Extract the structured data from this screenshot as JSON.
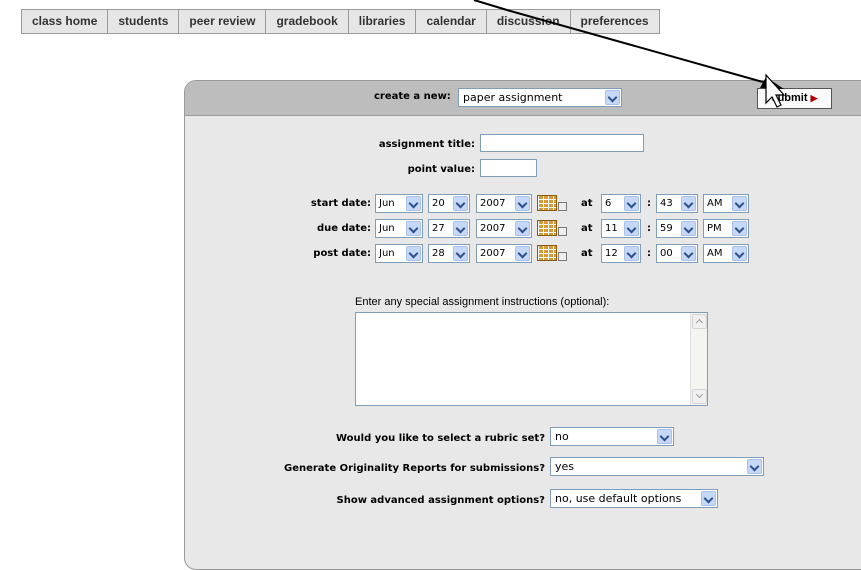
{
  "nav": {
    "tabs": [
      "class home",
      "students",
      "peer review",
      "gradebook",
      "libraries",
      "calendar",
      "discussion",
      "preferences"
    ]
  },
  "header": {
    "create_label": "create a new:",
    "create_value": "paper assignment",
    "submit_label": "submit"
  },
  "form": {
    "title_label": "assignment title:",
    "title_value": "",
    "points_label": "point value:",
    "points_value": "",
    "at_label": "at",
    "colon": ":",
    "dates": [
      {
        "label": "start date:",
        "month": "Jun",
        "day": "20",
        "year": "2007",
        "hour": "6",
        "minute": "43",
        "ampm": "AM"
      },
      {
        "label": "due date:",
        "month": "Jun",
        "day": "27",
        "year": "2007",
        "hour": "11",
        "minute": "59",
        "ampm": "PM"
      },
      {
        "label": "post date:",
        "month": "Jun",
        "day": "28",
        "year": "2007",
        "hour": "12",
        "minute": "00",
        "ampm": "AM"
      }
    ],
    "instructions_label": "Enter any special assignment instructions (optional):",
    "instructions_value": "",
    "rubric_label": "Would you like to select a rubric set?",
    "rubric_value": "no",
    "originality_label": "Generate Originality Reports for submissions?",
    "originality_value": "yes",
    "advanced_label": "Show advanced assignment options?",
    "advanced_value": "no, use default options"
  },
  "icons": {
    "calendar": "calendar-icon",
    "dropdown": "chevron-down-icon",
    "submit_arrow": "triangle-right-icon"
  },
  "colors": {
    "panel_bg": "#e8e8e8",
    "header_bg": "#bdbdbd",
    "submit_arrow": "#b00000",
    "nav_bg": "#e6e6e6"
  }
}
